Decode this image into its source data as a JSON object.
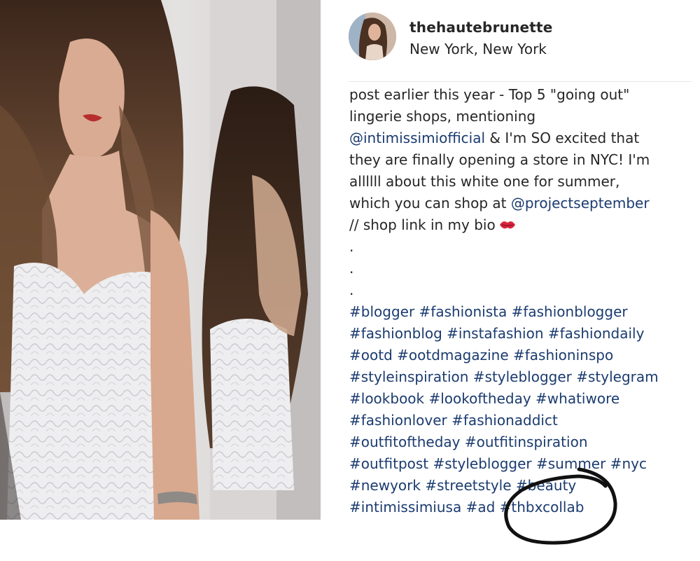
{
  "post": {
    "username": "thehautebrunette",
    "location": "New York, New York"
  },
  "caption": {
    "l1": "post earlier this year - Top 5 \"going out\"",
    "l2": "lingerie shops, mentioning",
    "l3_mention": "@intimissimiofficial",
    "l3_rest": " & I'm SO excited that",
    "l4": "they are finally opening a store in NYC! I'm",
    "l5": "allllll about this white one for summer,",
    "l6_pre": "which you can shop at ",
    "l6_mention": "@projectseptember",
    "l7": "// shop link in my bio",
    "dot": "."
  },
  "hashtags": {
    "t1": "#blogger #fashionista #fashionblogger",
    "t2": "#fashionblog #instafashion #fashiondaily",
    "t3": "#ootd #ootdmagazine #fashioninspo",
    "t4": "#styleinspiration #styleblogger #stylegram",
    "t5": "#lookbook #lookoftheday #whatiwore",
    "t6": "#fashionlover #fashionaddict",
    "t7": "#outfitoftheday #outfitinspiration",
    "t8": "#outfitpost #styleblogger #summer #nyc",
    "t9": "#newyork #streetstyle #beauty",
    "t10": "#intimissimiusa #ad #thbxcollab"
  },
  "colors": {
    "text": "#262626",
    "link": "#1b3b6f",
    "annotation": "#111111"
  },
  "icons": {
    "kiss": "kiss-mark-emoji"
  }
}
